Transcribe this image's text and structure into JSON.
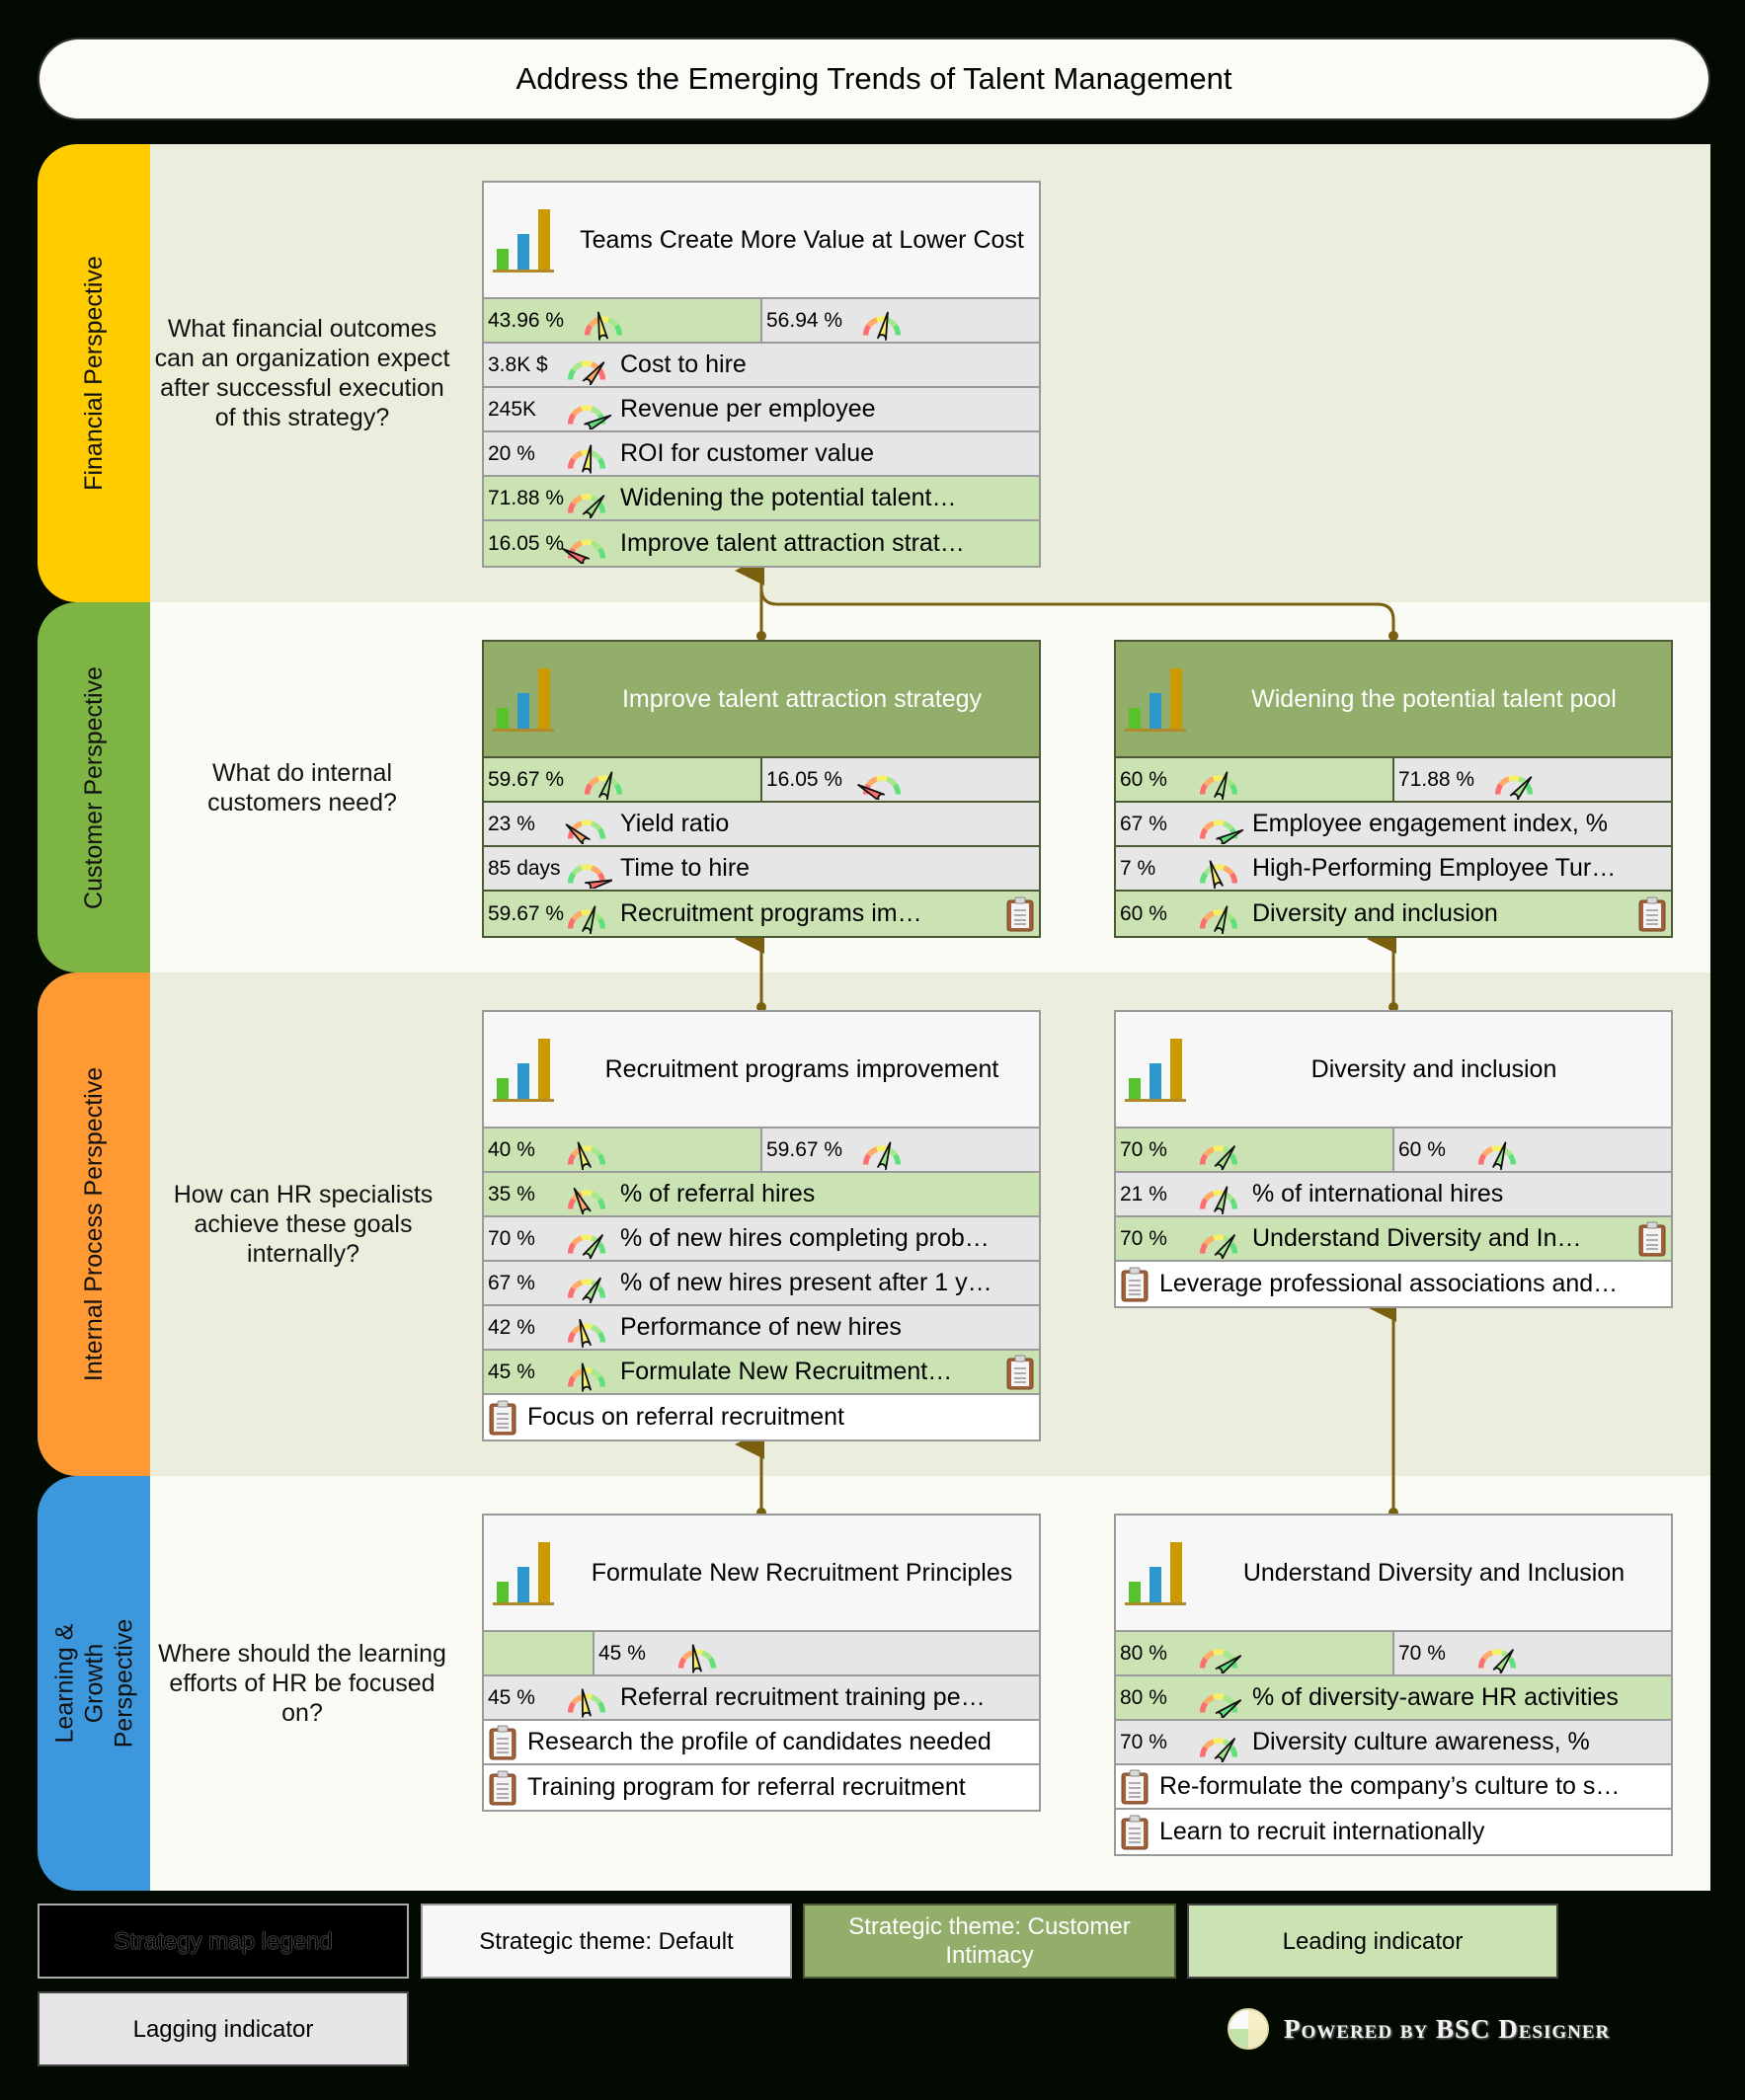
{
  "title": "Address the Emerging Trends of Talent Management",
  "colors": {
    "financial": "#FFCC00",
    "customer": "#7DB443",
    "internal": "#FF9933",
    "learning": "#3D97DC",
    "customer_intimacy_theme": "#93AD6A",
    "leading_indicator": "#CBE3B3",
    "lagging_indicator": "#E6E6E6",
    "connector": "#7A5F0E"
  },
  "perspectives": [
    {
      "name": "Financial Perspective",
      "question": "What financial outcomes can an organization expect after successful execution of this strategy?"
    },
    {
      "name": "Customer Perspective",
      "question": "What do internal customers need?"
    },
    {
      "name": "Internal Process Perspective",
      "question": "How can HR specialists achieve these goals internally?"
    },
    {
      "name": "Learning & Growth Perspective",
      "question": "Where should the learning efforts of HR be focused on?"
    }
  ],
  "goals": {
    "teams_value": {
      "title": "Teams Create More Value at Lower Cost",
      "theme": "Default",
      "summary": [
        {
          "value": "43.96 %",
          "type": "leading",
          "gauge": 0.44
        },
        {
          "value": "56.94 %",
          "type": "lagging",
          "gauge": 0.57
        }
      ],
      "rows": [
        {
          "kind": "indicator",
          "type": "lagging",
          "value": "3.8K $",
          "name": "Cost to hire",
          "gauge": 0.72,
          "reversed": true
        },
        {
          "kind": "indicator",
          "type": "lagging",
          "value": "245K",
          "name": "Revenue per employee",
          "gauge": 0.85
        },
        {
          "kind": "indicator",
          "type": "lagging",
          "value": "20 %",
          "name": "ROI for customer value",
          "gauge": 0.55
        },
        {
          "kind": "indicator",
          "type": "leading",
          "value": "71.88 %",
          "name": "Widening the potential talent…",
          "gauge": 0.72
        },
        {
          "kind": "indicator",
          "type": "leading",
          "value": "16.05 %",
          "name": "Improve talent attraction strat…",
          "gauge": 0.16
        }
      ]
    },
    "talent_attraction": {
      "title": "Improve talent attraction strategy",
      "theme": "Customer Intimacy",
      "summary": [
        {
          "value": "59.67 %",
          "type": "leading",
          "gauge": 0.6
        },
        {
          "value": "16.05 %",
          "type": "lagging",
          "gauge": 0.16
        }
      ],
      "rows": [
        {
          "kind": "indicator",
          "type": "lagging",
          "value": "23 %",
          "name": "Yield ratio",
          "gauge": 0.23
        },
        {
          "kind": "indicator",
          "type": "lagging",
          "value": "85 days",
          "name": "Time to hire",
          "gauge": 0.92,
          "reversed": true
        },
        {
          "kind": "indicator",
          "type": "leading",
          "value": "59.67 %",
          "name": "Recruitment programs im…",
          "gauge": 0.6,
          "clipboard": true
        }
      ]
    },
    "talent_pool": {
      "title": "Widening the potential talent pool",
      "theme": "Customer Intimacy",
      "summary": [
        {
          "value": "60 %",
          "type": "leading",
          "gauge": 0.6
        },
        {
          "value": "71.88 %",
          "type": "lagging",
          "gauge": 0.72
        }
      ],
      "rows": [
        {
          "kind": "indicator",
          "type": "lagging",
          "value": "67 %",
          "name": "Employee engagement index, %",
          "gauge": 0.85
        },
        {
          "kind": "indicator",
          "type": "lagging",
          "value": "7 %",
          "name": "High-Performing Employee Tur…",
          "gauge": 0.4,
          "reversed": true
        },
        {
          "kind": "indicator",
          "type": "leading",
          "value": "60 %",
          "name": "Diversity and inclusion",
          "gauge": 0.6,
          "clipboard": true
        }
      ]
    },
    "recruitment_programs": {
      "title": "Recruitment programs improvement",
      "theme": "Default",
      "summary": [
        {
          "value": "40 %",
          "type": "leading",
          "gauge": 0.4
        },
        {
          "value": "59.67 %",
          "type": "lagging",
          "gauge": 0.6
        }
      ],
      "rows": [
        {
          "kind": "indicator",
          "type": "leading",
          "value": "35 %",
          "name": "% of referral hires",
          "gauge": 0.35
        },
        {
          "kind": "indicator",
          "type": "lagging",
          "value": "70 %",
          "name": "% of new hires completing prob…",
          "gauge": 0.7
        },
        {
          "kind": "indicator",
          "type": "lagging",
          "value": "67 %",
          "name": "% of new hires present after 1 y…",
          "gauge": 0.67
        },
        {
          "kind": "indicator",
          "type": "lagging",
          "value": "42 %",
          "name": "Performance of new hires",
          "gauge": 0.42
        },
        {
          "kind": "indicator",
          "type": "leading",
          "value": "45 %",
          "name": "Formulate New Recruitment…",
          "gauge": 0.45,
          "clipboard": true
        },
        {
          "kind": "initiative",
          "name": "Focus on referral recruitment"
        }
      ]
    },
    "diversity_inclusion": {
      "title": "Diversity and inclusion",
      "theme": "Default",
      "summary": [
        {
          "value": "70 %",
          "type": "leading",
          "gauge": 0.7
        },
        {
          "value": "60 %",
          "type": "lagging",
          "gauge": 0.6
        }
      ],
      "rows": [
        {
          "kind": "indicator",
          "type": "lagging",
          "value": "21 %",
          "name": "% of international hires",
          "gauge": 0.6
        },
        {
          "kind": "indicator",
          "type": "leading",
          "value": "70 %",
          "name": "Understand Diversity and In…",
          "gauge": 0.7,
          "clipboard": true
        },
        {
          "kind": "initiative",
          "name": "Leverage professional associations and…"
        }
      ]
    },
    "recruitment_principles": {
      "title": "Formulate New Recruitment Principles",
      "theme": "Default",
      "summary": [
        {
          "value": "",
          "type": "leading",
          "gauge": null
        },
        {
          "value": "45 %",
          "type": "lagging",
          "gauge": 0.45
        }
      ],
      "rows": [
        {
          "kind": "indicator",
          "type": "lagging",
          "value": "45 %",
          "name": "Referral recruitment training pe…",
          "gauge": 0.45
        },
        {
          "kind": "initiative",
          "name": "Research the profile of candidates needed"
        },
        {
          "kind": "initiative",
          "name": "Training program for referral recruitment"
        }
      ]
    },
    "understand_diversity": {
      "title": "Understand Diversity and Inclusion",
      "theme": "Default",
      "summary": [
        {
          "value": "80 %",
          "type": "leading",
          "gauge": 0.8
        },
        {
          "value": "70 %",
          "type": "lagging",
          "gauge": 0.7
        }
      ],
      "rows": [
        {
          "kind": "indicator",
          "type": "leading",
          "value": "80 %",
          "name": "% of diversity-aware HR activities",
          "gauge": 0.8
        },
        {
          "kind": "indicator",
          "type": "lagging",
          "value": "70 %",
          "name": "Diversity culture awareness, %",
          "gauge": 0.7
        },
        {
          "kind": "initiative",
          "name": "Re-formulate the company’s culture to s…"
        },
        {
          "kind": "initiative",
          "name": "Learn to recruit internationally"
        }
      ]
    }
  },
  "legend": {
    "title": "Strategy map legend",
    "default_theme": "Strategic theme: Default",
    "customer_theme": "Strategic theme: Customer Intimacy",
    "leading": "Leading indicator",
    "lagging": "Lagging indicator"
  },
  "powered_by": "Powered by BSC Designer"
}
